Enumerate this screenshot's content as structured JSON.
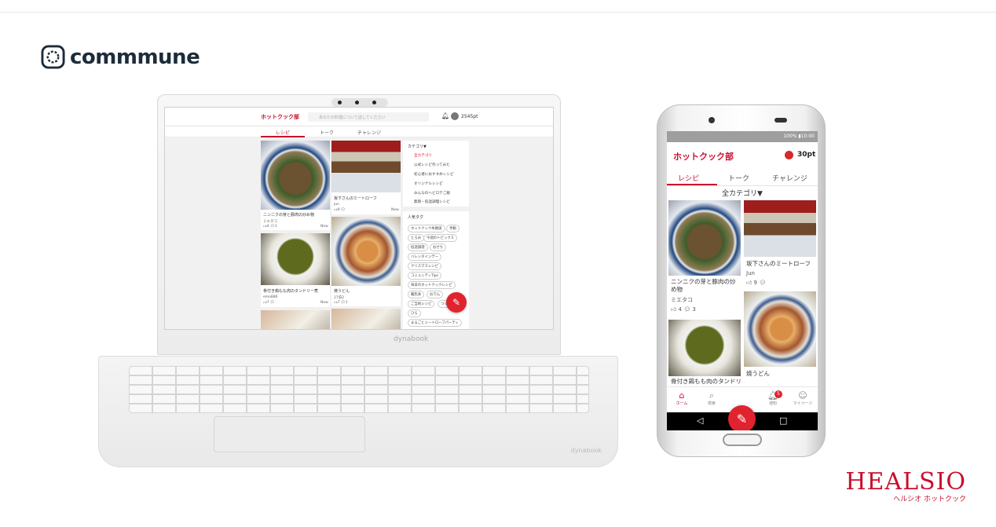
{
  "brand": {
    "name": "commmune",
    "icon": "commmune-logo-icon"
  },
  "partner": {
    "name": "HEALSIO",
    "subtitle": "ヘルシオ ホットクック"
  },
  "laptop": {
    "device_brand": "dynabook",
    "app": {
      "logo": "ホットクック部",
      "search_placeholder": "あなたの料理について話してください",
      "points": "2545pt",
      "tabs": [
        {
          "label": "レシピ"
        },
        {
          "label": "トーク"
        },
        {
          "label": "チャレンジ"
        }
      ],
      "cards": [
        {
          "title": "ニンニクの芽と豚肉の炒め物",
          "author": "ミエタコ",
          "likes": "4",
          "comments": "3",
          "badge": "New"
        },
        {
          "title": "坂下さんのミートローフ",
          "author": "Jun",
          "likes": "9",
          "comments": "",
          "badge": "New"
        },
        {
          "title": "骨付き鶏もも肉のタンドリー煮",
          "author": "emo886",
          "likes": "7",
          "comments": "",
          "badge": "New"
        },
        {
          "title": "焼うどん",
          "author": "27倍2",
          "likes": "7",
          "comments": "1",
          "badge": ""
        }
      ],
      "category_panel": {
        "title": "カテゴリ▼",
        "items": [
          "全カテゴリ",
          "公式レシピ作ってみた",
          "初心者におすすめレシピ",
          "オリジナルレシピ",
          "みんなのヘビロテご飯",
          "無限・低温調理レシピ"
        ]
      },
      "tags_panel": {
        "title": "人気タグ",
        "tags": [
          "ホットクック失敗談",
          "手動",
          "とろみ",
          "今週のトピックス",
          "低温調理",
          "おせち",
          "バレンタインデー",
          "クリスマスレシピ",
          "コミュニティTips",
          "毎日のホットクックレシピ",
          "離乳食",
          "おでん",
          "ご当地レシピ",
          "つくれ",
          "ひら",
          "まるごとミートローフパーティ"
        ]
      }
    }
  },
  "phone": {
    "status": "100% ▮10:00",
    "app": {
      "logo": "ホットクック部",
      "points": "30pt",
      "tabs": [
        {
          "label": "レシピ"
        },
        {
          "label": "トーク"
        },
        {
          "label": "チャレンジ"
        }
      ],
      "category": "全カテゴリ▼",
      "cards": [
        {
          "title": "ニンニクの芽と豚肉の炒め物",
          "author": "ミエタコ",
          "likes": "4",
          "comments": "3"
        },
        {
          "title": "坂下さんのミートローフ",
          "author": "Jun",
          "likes": "9",
          "comments": ""
        },
        {
          "title": "骨付き鶏もも肉のタンドリー",
          "author": "",
          "likes": "",
          "comments": ""
        },
        {
          "title": "焼うどん",
          "author": "",
          "likes": "",
          "comments": ""
        }
      ],
      "nav": [
        {
          "label": "ホーム",
          "icon": "home-icon"
        },
        {
          "label": "検索",
          "icon": "search-icon"
        },
        {
          "label": "通知",
          "icon": "bell-icon",
          "badge": "5"
        },
        {
          "label": "マイページ",
          "icon": "user-icon"
        }
      ]
    }
  },
  "colors": {
    "accent": "#c8102e",
    "fab": "#e0232e",
    "brand_dark": "#1d2c3a"
  }
}
